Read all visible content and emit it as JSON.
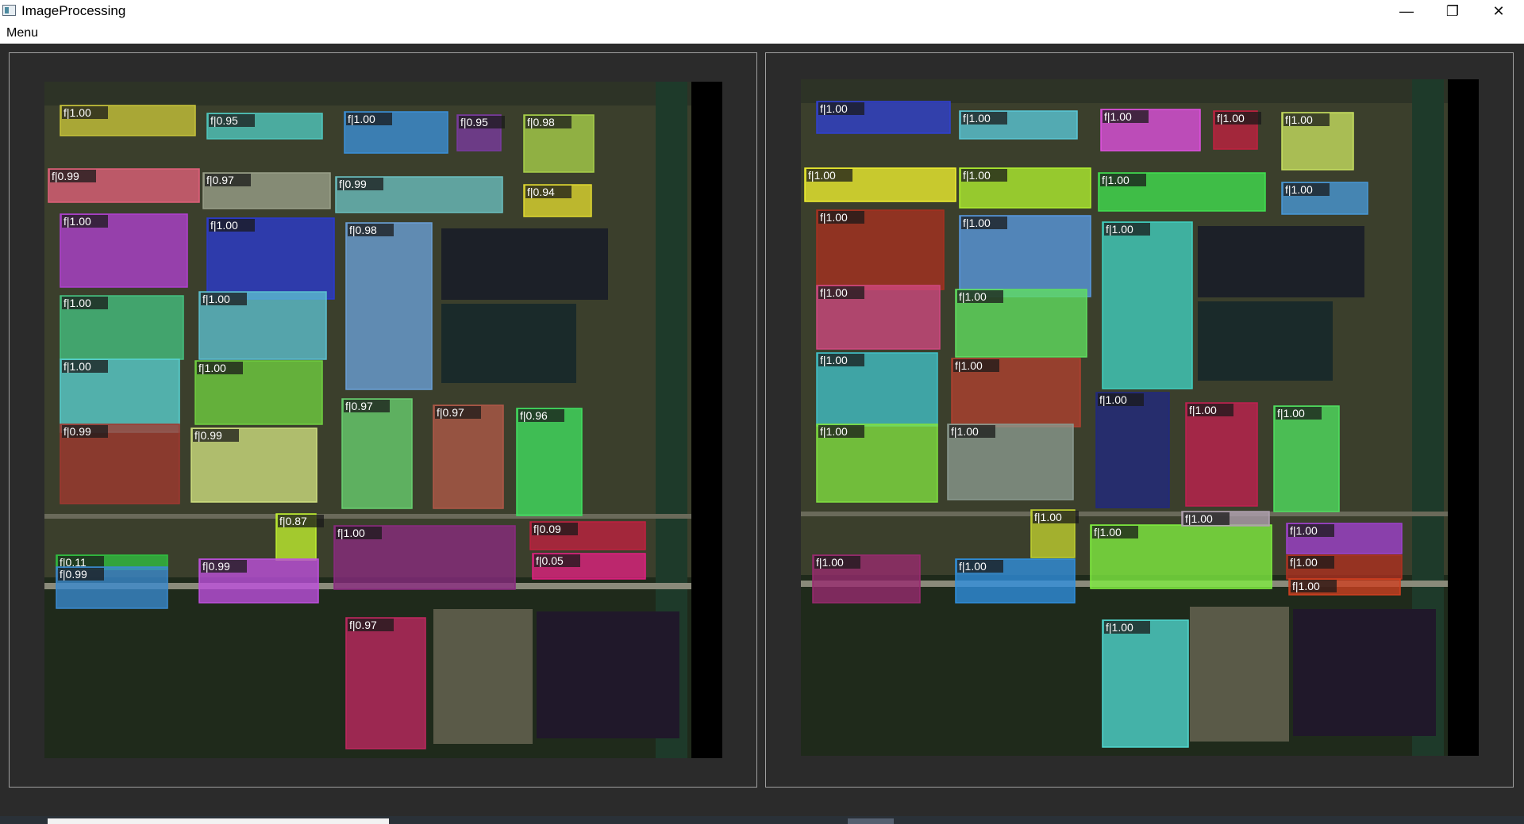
{
  "window": {
    "title": "ImageProcessing",
    "icon": "image-app-icon",
    "controls": [
      "minimize-icon",
      "restore-icon",
      "close-icon"
    ],
    "minimize_glyph": "—",
    "restore_glyph": "❐",
    "close_glyph": "✕"
  },
  "menubar": {
    "menu_label": "Menu"
  },
  "panels": {
    "left": {
      "labels": [
        "f|1.00",
        "f|0.95",
        "f|1.00",
        "f|0.95",
        "f|0.98",
        "f|0.99",
        "f|0.97",
        "f|0.99",
        "f|0.94",
        "f|1.00",
        "f|1.00",
        "f|0.98",
        "f|1.00",
        "f|1.00",
        "f|1.00",
        "f|1.00",
        "f|0.97",
        "f|0.97",
        "f|0.96",
        "f|0.99",
        "f|0.99",
        "f|0.87",
        "f|1.00",
        "f|0.09",
        "f|0.11",
        "f|0.05",
        "f|0.99",
        "f|0.99",
        "f|0.97"
      ],
      "colors": [
        "#c8c43a",
        "#4fc9c0",
        "#3b8fd8",
        "#7a3aa0",
        "#a8d04a",
        "#e0607a",
        "#9aa08a",
        "#6abfc0",
        "#e0d830",
        "#b040d0",
        "#2a3ad0",
        "#6aa0d8",
        "#44c080",
        "#5cc0d0",
        "#58d0d0",
        "#70d040",
        "#68d070",
        "#b05848",
        "#40e060",
        "#a03830",
        "#d0e080",
        "#c0f030",
        "#8a2a80",
        "#c02040",
        "#30c040",
        "#e02080",
        "#3a8ad0",
        "#c050e0",
        "#c02860"
      ]
    },
    "right": {
      "labels": [
        "f|1.00",
        "f|1.00",
        "f|1.00",
        "f|1.00",
        "f|1.00",
        "f|1.00",
        "f|1.00",
        "f|1.00",
        "f|1.00",
        "f|1.00",
        "f|1.00",
        "f|1.00",
        "f|1.00",
        "f|1.00",
        "f|1.00",
        "f|1.00",
        "f|1.00",
        "f|1.00",
        "f|1.00",
        "f|1.00",
        "f|1.00",
        "f|1.00",
        "f|1.00",
        "f|1.00",
        "f|1.00",
        "f|1.00",
        "f|1.00",
        "f|1.00",
        "f|1.00",
        "f|1.00"
      ],
      "colors": [
        "#3040d0",
        "#5ac8d8",
        "#e050e0",
        "#c02040",
        "#c8e060",
        "#f0f030",
        "#b0f030",
        "#40e050",
        "#4898d8",
        "#a83020",
        "#5898e0",
        "#40d0c0",
        "#d04880",
        "#60e060",
        "#40c0c8",
        "#b04030",
        "#202880",
        "#c02050",
        "#50e060",
        "#80e040",
        "#8a9a90",
        "#c0d030",
        "#80f040",
        "#a040d0",
        "#9a2a70",
        "#3090e0",
        "#b03020",
        "#d04020",
        "#50d8d0",
        "#b0a0b0"
      ]
    }
  }
}
